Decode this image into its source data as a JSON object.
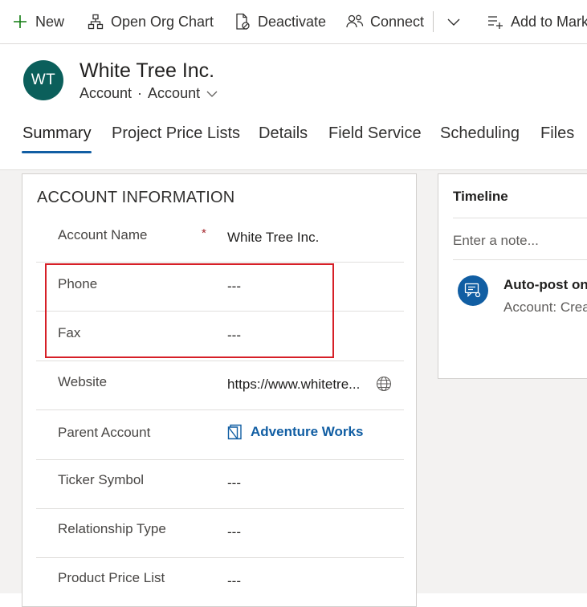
{
  "commandbar": {
    "items": [
      {
        "label": "New",
        "icon": "plus-icon"
      },
      {
        "label": "Open Org Chart",
        "icon": "org-chart-icon"
      },
      {
        "label": "Deactivate",
        "icon": "deactivate-icon"
      },
      {
        "label": "Connect",
        "icon": "connect-icon"
      },
      {
        "label": "Add to Mark",
        "icon": "add-to-list-icon"
      }
    ]
  },
  "record": {
    "initials": "WT",
    "name": "White Tree Inc.",
    "entity": "Account",
    "form": "Account"
  },
  "tabs": [
    "Summary",
    "Project Price Lists",
    "Details",
    "Field Service",
    "Scheduling",
    "Files"
  ],
  "account_info": {
    "title": "ACCOUNT INFORMATION",
    "fields": [
      {
        "label": "Account Name",
        "value": "White Tree Inc.",
        "required": "*"
      },
      {
        "label": "Phone",
        "value": "---"
      },
      {
        "label": "Fax",
        "value": "---"
      },
      {
        "label": "Website",
        "value": "https://www.whitetre..."
      },
      {
        "label": "Parent Account",
        "value": "Adventure Works"
      },
      {
        "label": "Ticker Symbol",
        "value": "---"
      },
      {
        "label": "Relationship Type",
        "value": "---"
      },
      {
        "label": "Product Price List",
        "value": "---"
      }
    ]
  },
  "timeline": {
    "title": "Timeline",
    "note_placeholder": "Enter a note...",
    "post_title": "Auto-post on",
    "post_subtitle": "Account: Crea"
  },
  "colors": {
    "accent": "#115ea3",
    "avatar": "#0b5f5b",
    "highlight": "#d61f27"
  }
}
